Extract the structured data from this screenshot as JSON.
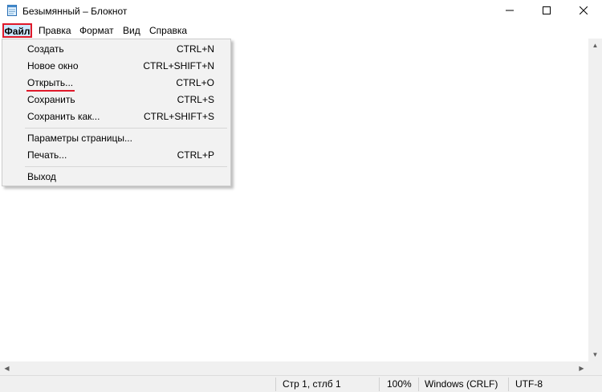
{
  "window": {
    "title": "Безымянный – Блокнот",
    "icons": {
      "app": "notepad-icon",
      "minimize": "minimize-icon",
      "maximize": "maximize-icon",
      "close": "close-icon"
    }
  },
  "menubar": {
    "items": [
      {
        "label": "Файл"
      },
      {
        "label": "Правка"
      },
      {
        "label": "Формат"
      },
      {
        "label": "Вид"
      },
      {
        "label": "Справка"
      }
    ],
    "active": "Файл"
  },
  "file_menu": {
    "items": [
      {
        "label": "Создать",
        "shortcut": "CTRL+N"
      },
      {
        "label": "Новое окно",
        "shortcut": "CTRL+SHIFT+N"
      },
      {
        "label": "Открыть...",
        "shortcut": "CTRL+O"
      },
      {
        "label": "Сохранить",
        "shortcut": "CTRL+S"
      },
      {
        "label": "Сохранить как...",
        "shortcut": "CTRL+SHIFT+S"
      },
      {
        "label": "Параметры страницы...",
        "shortcut": ""
      },
      {
        "label": "Печать...",
        "shortcut": "CTRL+P"
      },
      {
        "label": "Выход",
        "shortcut": ""
      }
    ]
  },
  "statusbar": {
    "position": "Стр 1, стлб 1",
    "zoom": "100%",
    "line_ending": "Windows (CRLF)",
    "encoding": "UTF-8"
  },
  "colors": {
    "highlight": "#cce8ff",
    "annotation_red": "#e0192a",
    "menu_bg": "#f2f2f2"
  }
}
